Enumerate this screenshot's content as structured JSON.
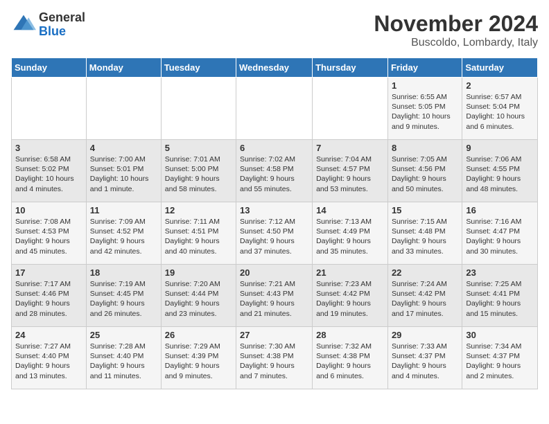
{
  "logo": {
    "general": "General",
    "blue": "Blue"
  },
  "title": "November 2024",
  "location": "Buscoldo, Lombardy, Italy",
  "days_of_week": [
    "Sunday",
    "Monday",
    "Tuesday",
    "Wednesday",
    "Thursday",
    "Friday",
    "Saturday"
  ],
  "weeks": [
    [
      {
        "day": "",
        "info": ""
      },
      {
        "day": "",
        "info": ""
      },
      {
        "day": "",
        "info": ""
      },
      {
        "day": "",
        "info": ""
      },
      {
        "day": "",
        "info": ""
      },
      {
        "day": "1",
        "info": "Sunrise: 6:55 AM\nSunset: 5:05 PM\nDaylight: 10 hours and 9 minutes."
      },
      {
        "day": "2",
        "info": "Sunrise: 6:57 AM\nSunset: 5:04 PM\nDaylight: 10 hours and 6 minutes."
      }
    ],
    [
      {
        "day": "3",
        "info": "Sunrise: 6:58 AM\nSunset: 5:02 PM\nDaylight: 10 hours and 4 minutes."
      },
      {
        "day": "4",
        "info": "Sunrise: 7:00 AM\nSunset: 5:01 PM\nDaylight: 10 hours and 1 minute."
      },
      {
        "day": "5",
        "info": "Sunrise: 7:01 AM\nSunset: 5:00 PM\nDaylight: 9 hours and 58 minutes."
      },
      {
        "day": "6",
        "info": "Sunrise: 7:02 AM\nSunset: 4:58 PM\nDaylight: 9 hours and 55 minutes."
      },
      {
        "day": "7",
        "info": "Sunrise: 7:04 AM\nSunset: 4:57 PM\nDaylight: 9 hours and 53 minutes."
      },
      {
        "day": "8",
        "info": "Sunrise: 7:05 AM\nSunset: 4:56 PM\nDaylight: 9 hours and 50 minutes."
      },
      {
        "day": "9",
        "info": "Sunrise: 7:06 AM\nSunset: 4:55 PM\nDaylight: 9 hours and 48 minutes."
      }
    ],
    [
      {
        "day": "10",
        "info": "Sunrise: 7:08 AM\nSunset: 4:53 PM\nDaylight: 9 hours and 45 minutes."
      },
      {
        "day": "11",
        "info": "Sunrise: 7:09 AM\nSunset: 4:52 PM\nDaylight: 9 hours and 42 minutes."
      },
      {
        "day": "12",
        "info": "Sunrise: 7:11 AM\nSunset: 4:51 PM\nDaylight: 9 hours and 40 minutes."
      },
      {
        "day": "13",
        "info": "Sunrise: 7:12 AM\nSunset: 4:50 PM\nDaylight: 9 hours and 37 minutes."
      },
      {
        "day": "14",
        "info": "Sunrise: 7:13 AM\nSunset: 4:49 PM\nDaylight: 9 hours and 35 minutes."
      },
      {
        "day": "15",
        "info": "Sunrise: 7:15 AM\nSunset: 4:48 PM\nDaylight: 9 hours and 33 minutes."
      },
      {
        "day": "16",
        "info": "Sunrise: 7:16 AM\nSunset: 4:47 PM\nDaylight: 9 hours and 30 minutes."
      }
    ],
    [
      {
        "day": "17",
        "info": "Sunrise: 7:17 AM\nSunset: 4:46 PM\nDaylight: 9 hours and 28 minutes."
      },
      {
        "day": "18",
        "info": "Sunrise: 7:19 AM\nSunset: 4:45 PM\nDaylight: 9 hours and 26 minutes."
      },
      {
        "day": "19",
        "info": "Sunrise: 7:20 AM\nSunset: 4:44 PM\nDaylight: 9 hours and 23 minutes."
      },
      {
        "day": "20",
        "info": "Sunrise: 7:21 AM\nSunset: 4:43 PM\nDaylight: 9 hours and 21 minutes."
      },
      {
        "day": "21",
        "info": "Sunrise: 7:23 AM\nSunset: 4:42 PM\nDaylight: 9 hours and 19 minutes."
      },
      {
        "day": "22",
        "info": "Sunrise: 7:24 AM\nSunset: 4:42 PM\nDaylight: 9 hours and 17 minutes."
      },
      {
        "day": "23",
        "info": "Sunrise: 7:25 AM\nSunset: 4:41 PM\nDaylight: 9 hours and 15 minutes."
      }
    ],
    [
      {
        "day": "24",
        "info": "Sunrise: 7:27 AM\nSunset: 4:40 PM\nDaylight: 9 hours and 13 minutes."
      },
      {
        "day": "25",
        "info": "Sunrise: 7:28 AM\nSunset: 4:40 PM\nDaylight: 9 hours and 11 minutes."
      },
      {
        "day": "26",
        "info": "Sunrise: 7:29 AM\nSunset: 4:39 PM\nDaylight: 9 hours and 9 minutes."
      },
      {
        "day": "27",
        "info": "Sunrise: 7:30 AM\nSunset: 4:38 PM\nDaylight: 9 hours and 7 minutes."
      },
      {
        "day": "28",
        "info": "Sunrise: 7:32 AM\nSunset: 4:38 PM\nDaylight: 9 hours and 6 minutes."
      },
      {
        "day": "29",
        "info": "Sunrise: 7:33 AM\nSunset: 4:37 PM\nDaylight: 9 hours and 4 minutes."
      },
      {
        "day": "30",
        "info": "Sunrise: 7:34 AM\nSunset: 4:37 PM\nDaylight: 9 hours and 2 minutes."
      }
    ]
  ]
}
